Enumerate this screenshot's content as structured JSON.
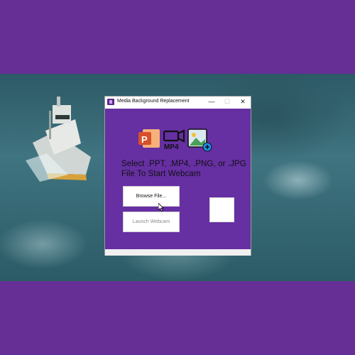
{
  "background": {
    "frame_color": "#652f96",
    "photo_subject": "boat-in-stormy-sea"
  },
  "window": {
    "title": "Media Background Replacement",
    "controls": {
      "minimize": "—",
      "maximize": "☐",
      "close": "✕"
    },
    "content_bg": "#662fa2"
  },
  "icons": [
    "powerpoint-icon",
    "mp4-icon",
    "image-add-icon"
  ],
  "icon_labels": {
    "powerpoint": "P",
    "mp4": "MP4"
  },
  "prompt": "Select .PPT, .MP4, .PNG, or .JPG File To Start Webcam",
  "buttons": {
    "browse": "Browse File...",
    "launch": "Launch Webcam"
  }
}
